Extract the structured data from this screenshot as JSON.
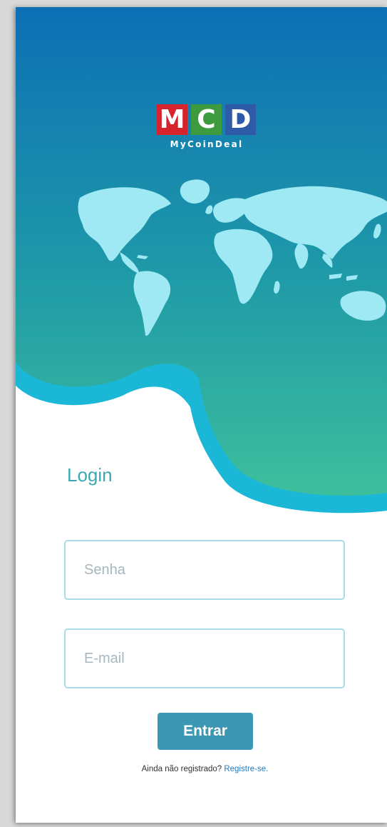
{
  "app": {
    "logo_letters": [
      "M",
      "C",
      "D"
    ],
    "logo_name": "MyCoinDeal"
  },
  "login": {
    "title": "Login",
    "password_placeholder": "Senha",
    "email_placeholder": "E-mail",
    "submit_label": "Entrar",
    "register_prompt": "Ainda não registrado? ",
    "register_link": "Registre-se."
  },
  "colors": {
    "gradient_top": "#0d6fb5",
    "gradient_bottom": "#3dbf9c",
    "wave": "#1ab8d6",
    "map": "#9fe9f4",
    "title": "#3aa9b3",
    "button": "#3c97b4",
    "field_border": "#a9dce6",
    "link": "#1f7cc4"
  },
  "icons": [
    "world-map-graphic"
  ]
}
